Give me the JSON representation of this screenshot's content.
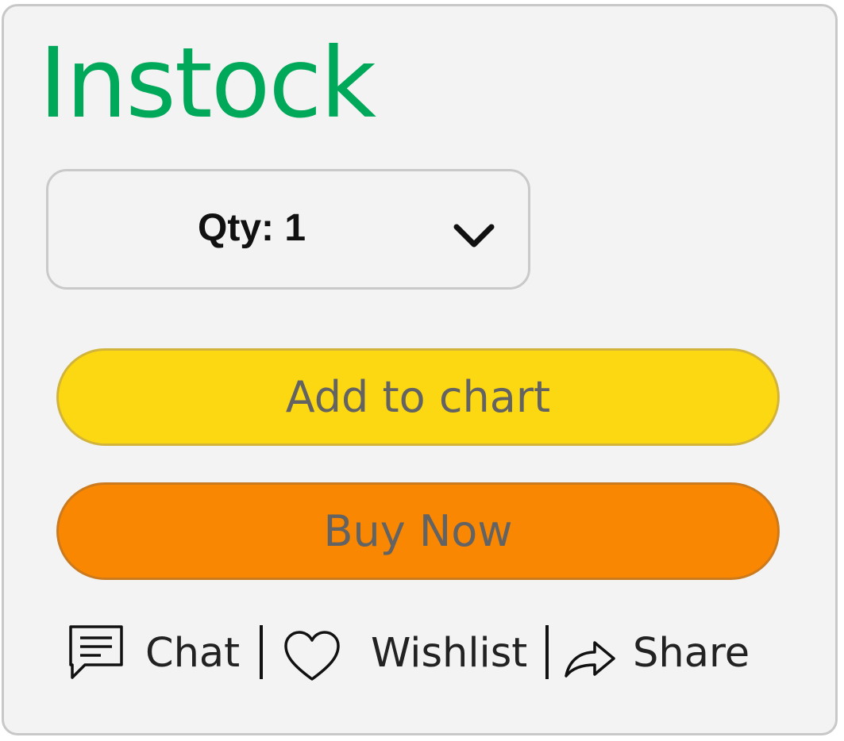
{
  "stock_status": "Instock",
  "quantity": {
    "label": "Qty: 1",
    "icon": "chevron-down-icon"
  },
  "buttons": {
    "add_to_cart": "Add to chart",
    "buy_now": "Buy Now"
  },
  "actions": [
    {
      "label": "Chat",
      "icon": "chat-icon"
    },
    {
      "label": "Wishlist",
      "icon": "heart-icon"
    },
    {
      "label": "Share",
      "icon": "share-icon"
    }
  ],
  "colors": {
    "stock_text": "#00a85a",
    "add_to_cart_bg": "#fcd813",
    "buy_now_bg": "#f98701",
    "card_bg": "#f3f3f3"
  }
}
